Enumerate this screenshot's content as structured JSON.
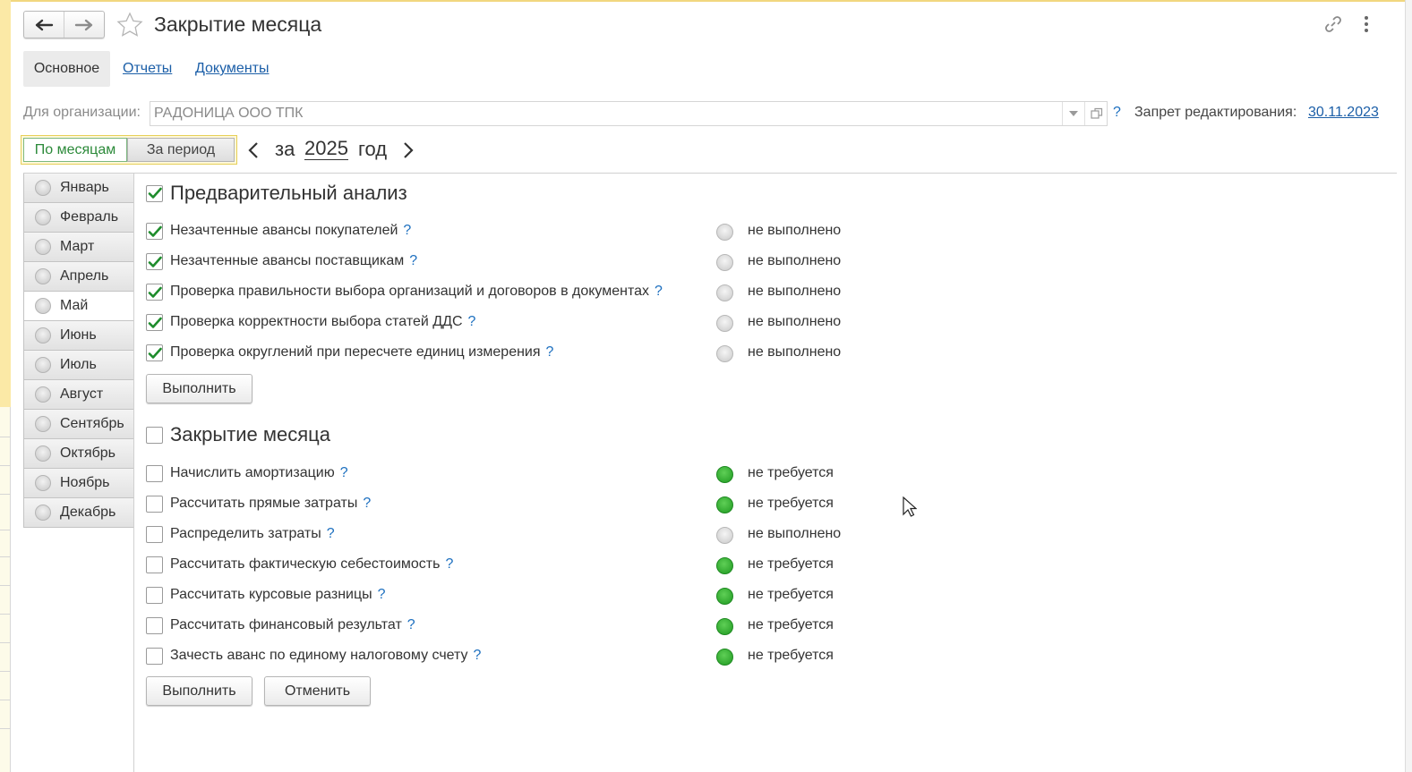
{
  "window": {
    "title": "Закрытие месяца",
    "back_icon": "arrow-left-icon",
    "forward_icon": "arrow-right-icon",
    "favorite_icon": "star-icon",
    "link_icon": "link-icon",
    "more_icon": "more-vertical-icon"
  },
  "tabs": [
    {
      "label": "Основное",
      "active": true
    },
    {
      "label": "Отчеты",
      "active": false
    },
    {
      "label": "Документы",
      "active": false
    }
  ],
  "organization": {
    "label": "Для организации:",
    "value": "РАДОНИЦА ООО ТПК",
    "help": "?"
  },
  "edit_ban": {
    "label": "Запрет редактирования:",
    "date": "30.11.2023"
  },
  "period": {
    "modes": [
      "По месяцам",
      "За период"
    ],
    "active_mode": "По месяцам",
    "prefix": "за",
    "year": "2025",
    "suffix": "год"
  },
  "months": [
    {
      "label": "Январь"
    },
    {
      "label": "Февраль"
    },
    {
      "label": "Март"
    },
    {
      "label": "Апрель"
    },
    {
      "label": "Май",
      "selected": true
    },
    {
      "label": "Июнь"
    },
    {
      "label": "Июль"
    },
    {
      "label": "Август"
    },
    {
      "label": "Сентябрь"
    },
    {
      "label": "Октябрь"
    },
    {
      "label": "Ноябрь"
    },
    {
      "label": "Декабрь"
    }
  ],
  "preliminary": {
    "title": "Предварительный анализ",
    "checked": true,
    "items": [
      {
        "label": "Незачтенные авансы покупателей",
        "help": "?",
        "checked": true,
        "status": "не выполнено",
        "status_color": "grey"
      },
      {
        "label": "Незачтенные авансы поставщикам",
        "help": "?",
        "checked": true,
        "status": "не выполнено",
        "status_color": "grey"
      },
      {
        "label": "Проверка правильности выбора организаций и договоров в документах",
        "help": "?",
        "checked": true,
        "status": "не выполнено",
        "status_color": "grey"
      },
      {
        "label": "Проверка корректности выбора статей ДДС",
        "help": "?",
        "checked": true,
        "status": "не выполнено",
        "status_color": "grey"
      },
      {
        "label": "Проверка округлений при пересчете единиц измерения",
        "help": "?",
        "checked": true,
        "status": "не выполнено",
        "status_color": "grey"
      }
    ],
    "run_button": "Выполнить"
  },
  "closing": {
    "title": "Закрытие месяца",
    "checked": false,
    "items": [
      {
        "label": "Начислить амортизацию",
        "help": "?",
        "checked": false,
        "status": "не требуется",
        "status_color": "green"
      },
      {
        "label": "Рассчитать прямые затраты",
        "help": "?",
        "checked": false,
        "status": "не требуется",
        "status_color": "green"
      },
      {
        "label": "Распределить затраты",
        "help": "?",
        "checked": false,
        "status": "не выполнено",
        "status_color": "grey"
      },
      {
        "label": "Рассчитать фактическую себестоимость",
        "help": "?",
        "checked": false,
        "status": "не требуется",
        "status_color": "green"
      },
      {
        "label": "Рассчитать курсовые разницы",
        "help": "?",
        "checked": false,
        "status": "не требуется",
        "status_color": "green"
      },
      {
        "label": "Рассчитать финансовый результат",
        "help": "?",
        "checked": false,
        "status": "не требуется",
        "status_color": "green"
      },
      {
        "label": "Зачесть аванс по единому налоговому счету",
        "help": "?",
        "checked": false,
        "status": "не требуется",
        "status_color": "green"
      }
    ],
    "run_button": "Выполнить",
    "cancel_button": "Отменить"
  },
  "colors": {
    "link": "#1c5fa8",
    "status_green": "#1f9a21",
    "status_grey": "#c9c9c9",
    "active_mode": "#2c8a3a",
    "period_highlight": "#e6cf57"
  }
}
